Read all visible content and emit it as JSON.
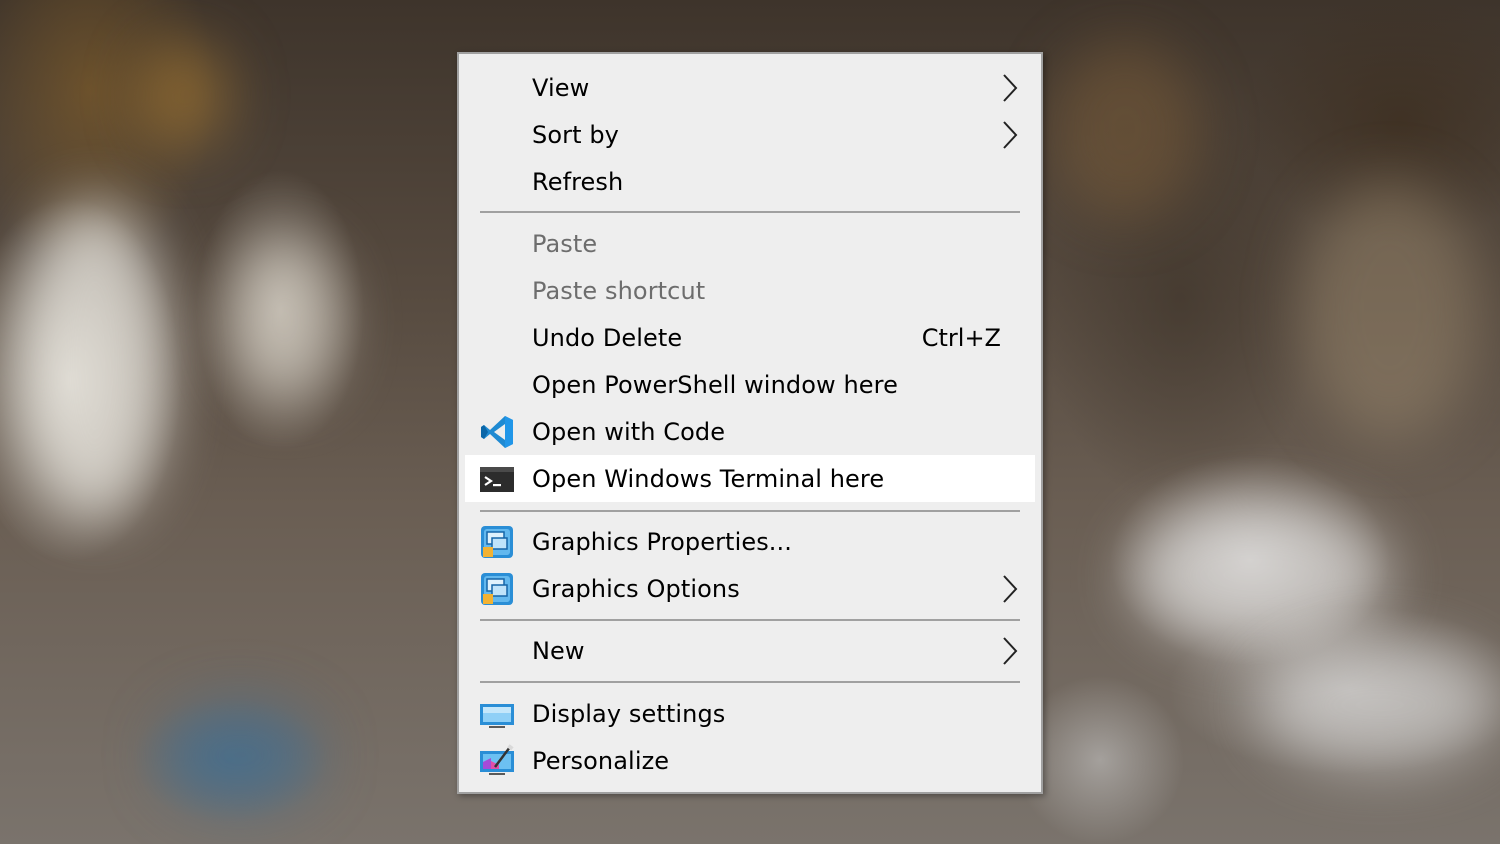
{
  "menu": {
    "group1": {
      "view": "View",
      "sort_by": "Sort by",
      "refresh": "Refresh"
    },
    "group2": {
      "paste": "Paste",
      "paste_shortcut": "Paste shortcut",
      "undo_delete": "Undo Delete",
      "undo_delete_shortcut": "Ctrl+Z",
      "open_powershell": "Open PowerShell window here",
      "open_with_code": "Open with Code",
      "open_windows_terminal": "Open Windows Terminal here"
    },
    "group3": {
      "graphics_properties": "Graphics Properties...",
      "graphics_options": "Graphics Options"
    },
    "group4": {
      "new": "New"
    },
    "group5": {
      "display_settings": "Display settings",
      "personalize": "Personalize"
    },
    "hovered_item": "Open Windows Terminal here",
    "disabled_items": [
      "Paste",
      "Paste shortcut"
    ],
    "icons": {
      "open_with_code": "vscode-icon",
      "open_windows_terminal": "terminal-icon",
      "graphics_properties": "intel-graphics-icon",
      "graphics_options": "intel-graphics-icon",
      "display_settings": "display-icon",
      "personalize": "personalize-icon"
    },
    "colors": {
      "background": "#eeeeee",
      "hover": "#ffffff",
      "disabled_text": "#6d6d6d",
      "separator": "#a0a0a0",
      "vscode_blue": "#1f8ad2"
    }
  }
}
